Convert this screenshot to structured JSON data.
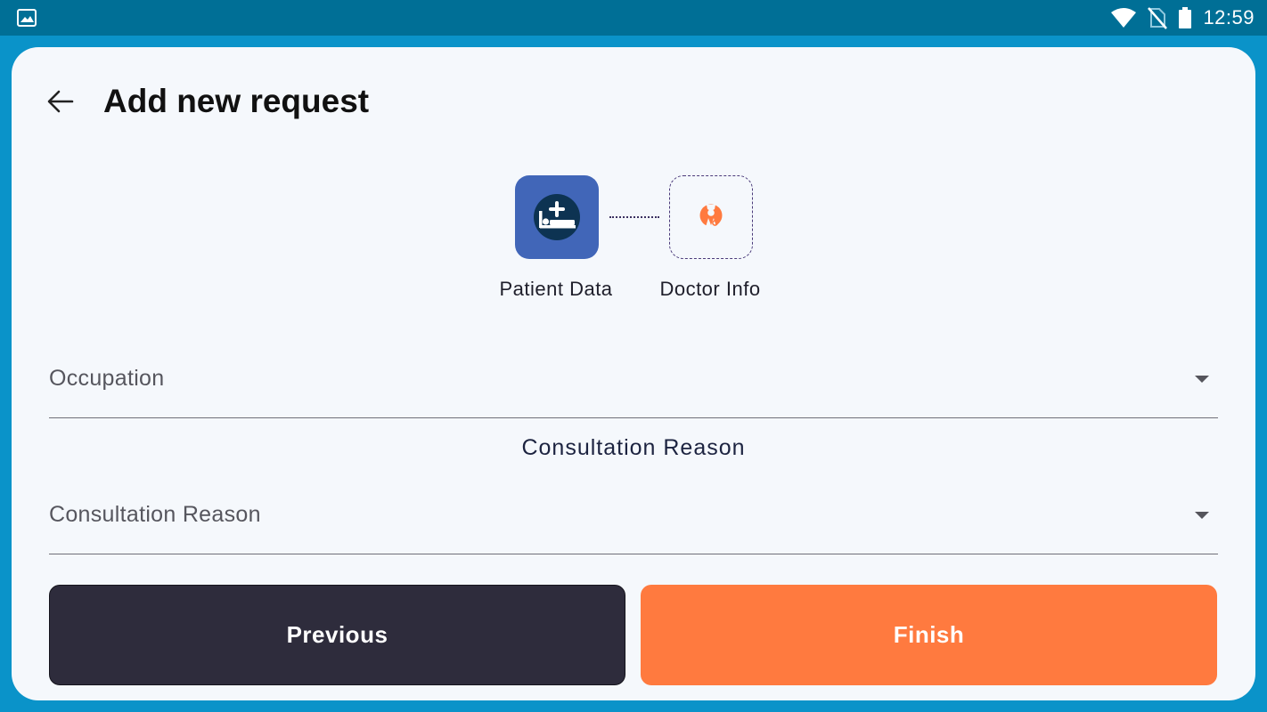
{
  "status_bar": {
    "time": "12:59",
    "icons": [
      "gallery-icon",
      "wifi-icon",
      "no-sim-icon",
      "battery-icon"
    ]
  },
  "header": {
    "back_icon": "arrow-left-icon",
    "title": "Add new request"
  },
  "steps": [
    {
      "label": "Patient Data",
      "icon": "patient-bed-icon",
      "state": "active"
    },
    {
      "label": "Doctor Info",
      "icon": "doctor-icon",
      "state": "pending"
    }
  ],
  "form": {
    "occupation": {
      "placeholder": "Occupation"
    },
    "section_title": "Consultation Reason",
    "consultation_reason": {
      "placeholder": "Consultation Reason"
    }
  },
  "buttons": {
    "previous": "Previous",
    "finish": "Finish"
  },
  "colors": {
    "status_bar": "#006f96",
    "frame": "#0a93c9",
    "card": "#f5f8fc",
    "step_active": "#4166b8",
    "previous_button": "#2e2c3c",
    "finish_button": "#ff7a3f",
    "doctor_icon": "#ff7a3f"
  }
}
